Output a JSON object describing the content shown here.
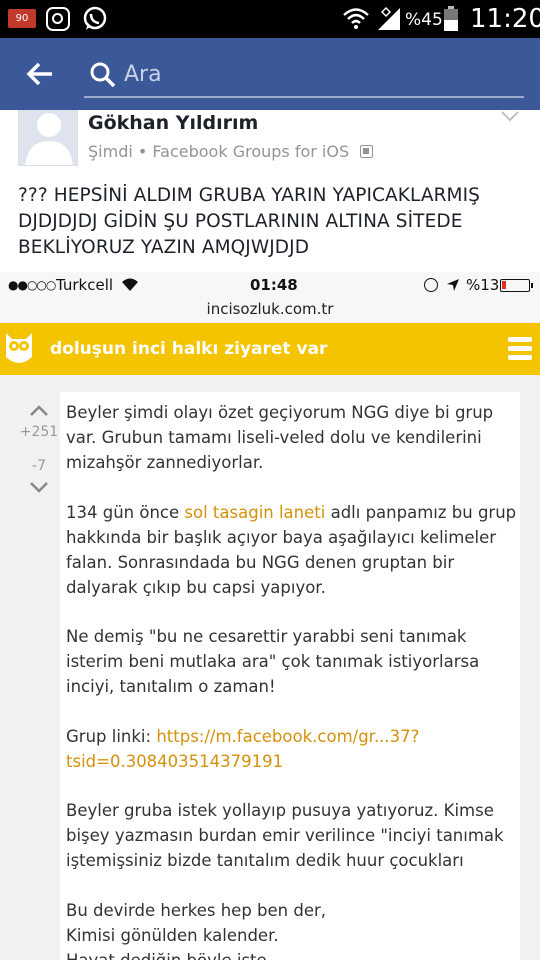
{
  "status_bar": {
    "notification_badge": "90",
    "battery_percent": "%45",
    "time": "11:20"
  },
  "header": {
    "search_placeholder": "Ara"
  },
  "post": {
    "author": "Gökhan Yıldırım",
    "time_label": "Şimdi",
    "separator": "•",
    "source": "Facebook Groups for iOS",
    "text": "??? HEPSİNİ ALDIM GRUBA YARIN YAPICAKLARMIŞ DJDJDJDJ GİDİN ŞU POSTLARININ ALTINA SİTEDE BEKLİYORUZ YAZIN AMQJWJDJD"
  },
  "screenshot": {
    "ios": {
      "signal_dots": "●●○○○",
      "carrier": "Turkcell",
      "time": "01:48",
      "battery_percent": "%13",
      "url": "incisozluk.com.tr"
    },
    "site_bar_title": "doluşun inci halkı ziyaret var",
    "votes": {
      "up_count": "+251",
      "down_count": "-7"
    },
    "entry": {
      "p1": "Beyler şimdi olayı özet geçiyorum NGG diye bi grup var. Grubun tamamı liseli-veled dolu ve kendilerini mizahşör zannediyorlar.",
      "p2_before": "134 gün önce ",
      "p2_link": "sol tasagin laneti",
      "p2_after": " adlı panpamız bu grup hakkında bir başlık açıyor baya aşağılayıcı kelimeler falan. Sonrasındada bu NGG denen gruptan bir dalyarak çıkıp bu capsi yapıyor.",
      "p3": "Ne demiş \"bu ne cesarettir yarabbi seni tanımak isterim beni mutlaka ara\" çok tanımak istiyorlarsa inciyi, tanıtalım o zaman!",
      "p4_label": "Grup linki:  ",
      "p4_link": "https://m.facebook.com/gr...37?tsid=0.308403514379191",
      "p5": "Beyler gruba istek yollayıp pusuya yatıyoruz. Kimse bişey yazmasın burdan emir verilince \"inciyi tanımak iştemişsiniz bizde tanıtalım dedik huur çocukları",
      "p6_line1": "Bu devirde herkes hep ben der,",
      "p6_line2": "Kimisi gönülden kalender.",
      "p6_line3": "Hayat dediğin böyle işte"
    }
  },
  "colors": {
    "facebook_blue": "#3b5998",
    "inci_yellow": "#f5c400",
    "link_orange": "#d4910a"
  }
}
